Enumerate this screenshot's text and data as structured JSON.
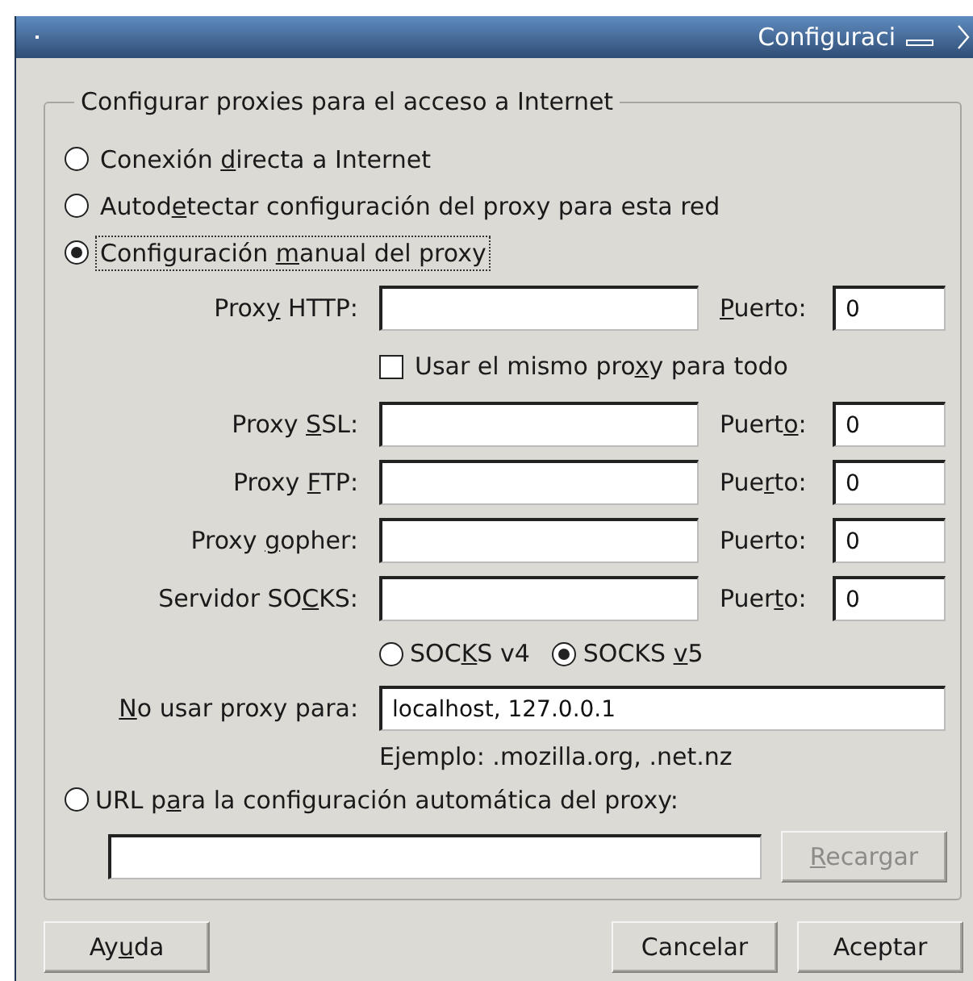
{
  "window": {
    "title": "Configuraci"
  },
  "group": {
    "title": "Configurar proxies para el acceso a Internet"
  },
  "modes": [
    {
      "label": [
        {
          "text": "Conexión "
        },
        {
          "text": "d",
          "key": true
        },
        {
          "text": "irecta a Internet"
        }
      ],
      "selected": false,
      "focused": false
    },
    {
      "label": [
        {
          "text": "Autod"
        },
        {
          "text": "e",
          "key": true
        },
        {
          "text": "tectar configuración del proxy para esta red"
        }
      ],
      "selected": false,
      "focused": false
    },
    {
      "label": [
        {
          "text": "Configuración "
        },
        {
          "text": "m",
          "key": true
        },
        {
          "text": "anual del proxy"
        }
      ],
      "selected": true,
      "focused": true
    }
  ],
  "proxies": [
    {
      "label": [
        {
          "text": "Prox"
        },
        {
          "text": "y",
          "key": true
        },
        {
          "text": " HTTP:"
        }
      ],
      "port_label": [
        {
          "text": "P",
          "key": true
        },
        {
          "text": "uerto:"
        }
      ],
      "port": "0"
    },
    {
      "label": [
        {
          "text": "Proxy "
        },
        {
          "text": "S",
          "key": true
        },
        {
          "text": "SL:"
        }
      ],
      "port_label": [
        {
          "text": "Puert"
        },
        {
          "text": "o",
          "key": true
        },
        {
          "text": ":"
        }
      ],
      "port": "0"
    },
    {
      "label": [
        {
          "text": "Proxy "
        },
        {
          "text": "F",
          "key": true
        },
        {
          "text": "TP:"
        }
      ],
      "port_label": [
        {
          "text": "Pue"
        },
        {
          "text": "r",
          "key": true
        },
        {
          "text": "to:"
        }
      ],
      "port": "0"
    },
    {
      "label": [
        {
          "text": "Proxy "
        },
        {
          "text": "g",
          "key": true
        },
        {
          "text": "opher:"
        }
      ],
      "port_label": [
        {
          "text": "Puerto:"
        }
      ],
      "port": "0"
    },
    {
      "label": [
        {
          "text": "Servidor SO"
        },
        {
          "text": "C",
          "key": true
        },
        {
          "text": "KS:"
        }
      ],
      "port_label": [
        {
          "text": "Puer"
        },
        {
          "text": "t",
          "key": true
        },
        {
          "text": "o:"
        }
      ],
      "port": "0"
    }
  ],
  "same_proxy": {
    "label": [
      {
        "text": "Usar el mismo pro"
      },
      {
        "text": "x",
        "key": true
      },
      {
        "text": "y para todo"
      }
    ],
    "checked": false
  },
  "socks_versions": [
    {
      "label": [
        {
          "text": "SOC"
        },
        {
          "text": "K",
          "key": true
        },
        {
          "text": "S v4"
        }
      ],
      "selected": false
    },
    {
      "label": [
        {
          "text": "SOCKS "
        },
        {
          "text": "v",
          "key": true
        },
        {
          "text": "5"
        }
      ],
      "selected": true
    }
  ],
  "no_proxy": {
    "label": [
      {
        "text": "N",
        "key": true
      },
      {
        "text": "o usar proxy para:"
      }
    ],
    "value": "localhost, 127.0.0.1",
    "example": "Ejemplo: .mozilla.org, .net.nz"
  },
  "auto_url": {
    "label": [
      {
        "text": "URL p"
      },
      {
        "text": "a",
        "key": true
      },
      {
        "text": "ra la configuración automática del proxy:"
      }
    ],
    "selected": false,
    "reload": {
      "label": [
        {
          "text": "R",
          "key": true
        },
        {
          "text": "ecargar"
        }
      ],
      "disabled": true
    }
  },
  "help_button": {
    "label": [
      {
        "text": "Ay"
      },
      {
        "text": "u",
        "key": true
      },
      {
        "text": "da"
      }
    ]
  },
  "buttons": [
    {
      "label": [
        {
          "text": "Cancelar"
        }
      ]
    },
    {
      "label": [
        {
          "text": "Aceptar"
        }
      ]
    }
  ]
}
